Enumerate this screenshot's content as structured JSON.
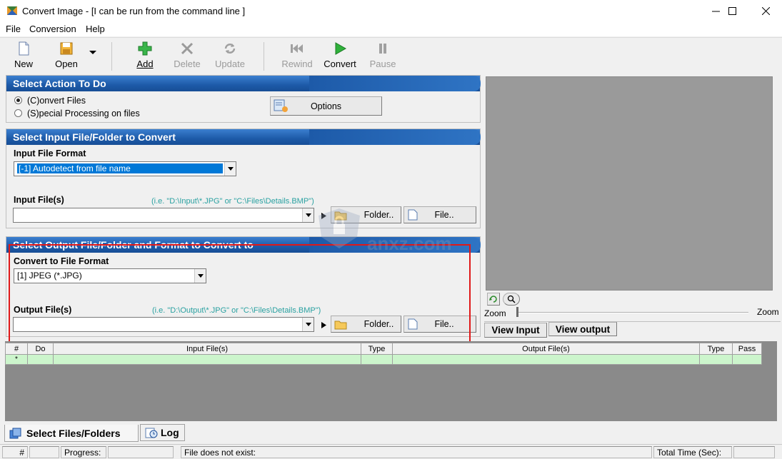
{
  "window": {
    "title": "Convert Image - [I can be run from the command line ]"
  },
  "menu": [
    "File",
    "Conversion",
    "Help"
  ],
  "toolbar": {
    "new": "New",
    "open": "Open",
    "add": "Add",
    "delete": "Delete",
    "update": "Update",
    "rewind": "Rewind",
    "convert": "Convert",
    "pause": "Pause"
  },
  "action": {
    "header": "Select Action To Do",
    "convert_files": "(C)onvert Files",
    "special": "(S)pecial Processing on files",
    "options": "Options"
  },
  "input": {
    "header": "Select Input File/Folder to Convert",
    "format_label": "Input File Format",
    "format_value": "[-1] Autodetect from file name",
    "files_label": "Input File(s)",
    "hint": "(i.e. \"D:\\Input\\*.JPG\"  or  \"C:\\Files\\Details.BMP\")",
    "folder_btn": "Folder..",
    "file_btn": "File.."
  },
  "output": {
    "header": "Select Output File/Folder and Format to Convert to",
    "format_label": "Convert to File Format",
    "format_value": "[1] JPEG (*.JPG)",
    "files_label": "Output File(s)",
    "hint": "(i.e. \"D:\\Output\\*.JPG\"  or  \"C:\\Files\\Details.BMP\")",
    "folder_btn": "Folder..",
    "file_btn": "File.."
  },
  "preview": {
    "zoom_left": "Zoom",
    "zoom_right": "Zoom",
    "view_input": "View Input",
    "view_output": "View output"
  },
  "grid": {
    "columns": [
      "#",
      "Do",
      "Input File(s)",
      "Type",
      "Output File(s)",
      "Type",
      "Pass"
    ],
    "new_row_marker": "*"
  },
  "tabs": {
    "select_files": "Select Files/Folders",
    "log": "Log"
  },
  "status": {
    "hash": "#",
    "progress": "Progress:",
    "message": "File does not exist:",
    "total_time": "Total Time (Sec):"
  },
  "watermark": "anxz.com",
  "colors": {
    "header_blue": "#1d5aa8",
    "grid_row": "#ccf5cc",
    "highlight": "#e01818",
    "hint": "#2aa1a1"
  }
}
